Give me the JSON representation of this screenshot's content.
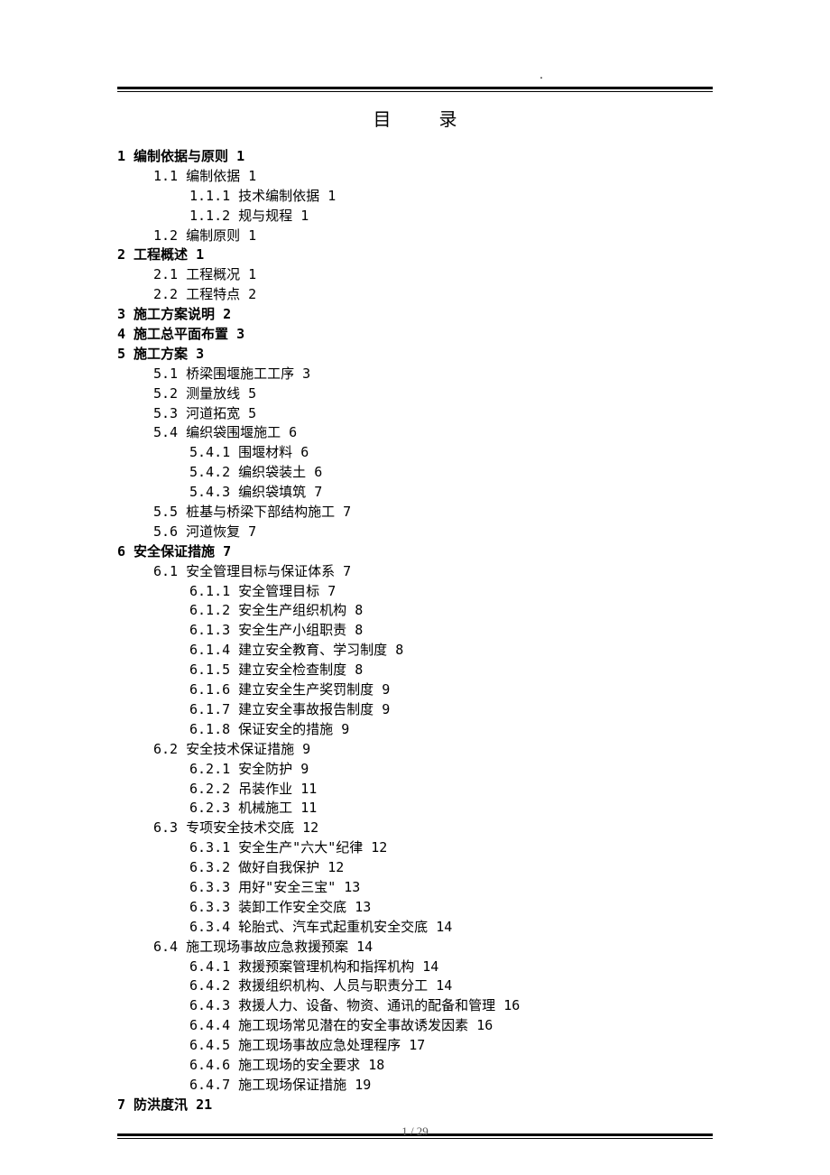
{
  "header_mark": ".",
  "title": "目  录",
  "page_number": "1 / 29",
  "toc": [
    {
      "level": 0,
      "label": "1 编制依据与原则",
      "page": "1"
    },
    {
      "level": 1,
      "label": "1.1 编制依据",
      "page": "1"
    },
    {
      "level": 2,
      "label": "1.1.1 技术编制依据",
      "page": "1"
    },
    {
      "level": 2,
      "label": "1.1.2 规与规程",
      "page": "1"
    },
    {
      "level": 1,
      "label": "1.2 编制原则",
      "page": "1"
    },
    {
      "level": 0,
      "label": "2 工程概述",
      "page": "1"
    },
    {
      "level": 1,
      "label": "2.1 工程概况",
      "page": "1"
    },
    {
      "level": 1,
      "label": "2.2 工程特点",
      "page": "2"
    },
    {
      "level": 0,
      "label": "3 施工方案说明",
      "page": "2"
    },
    {
      "level": 0,
      "label": "4 施工总平面布置",
      "page": "3"
    },
    {
      "level": 0,
      "label": "5 施工方案",
      "page": "3"
    },
    {
      "level": 1,
      "label": "5.1 桥梁围堰施工工序",
      "page": "3"
    },
    {
      "level": 1,
      "label": "5.2 测量放线",
      "page": "5"
    },
    {
      "level": 1,
      "label": "5.3 河道拓宽",
      "page": "5"
    },
    {
      "level": 1,
      "label": "5.4 编织袋围堰施工",
      "page": "6"
    },
    {
      "level": 2,
      "label": "5.4.1 围堰材料",
      "page": "6"
    },
    {
      "level": 2,
      "label": "5.4.2 编织袋装土",
      "page": "6"
    },
    {
      "level": 2,
      "label": "5.4.3 编织袋填筑",
      "page": "7"
    },
    {
      "level": 1,
      "label": "5.5 桩基与桥梁下部结构施工",
      "page": "7"
    },
    {
      "level": 1,
      "label": "5.6 河道恢复",
      "page": "7"
    },
    {
      "level": 0,
      "label": "6 安全保证措施",
      "page": "7"
    },
    {
      "level": 1,
      "label": "6.1 安全管理目标与保证体系",
      "page": "7"
    },
    {
      "level": 2,
      "label": "6.1.1 安全管理目标",
      "page": "7"
    },
    {
      "level": 2,
      "label": "6.1.2 安全生产组织机构",
      "page": "8"
    },
    {
      "level": 2,
      "label": "6.1.3 安全生产小组职责",
      "page": "8"
    },
    {
      "level": 2,
      "label": "6.1.4 建立安全教育、学习制度",
      "page": "8"
    },
    {
      "level": 2,
      "label": "6.1.5 建立安全检查制度",
      "page": "8"
    },
    {
      "level": 2,
      "label": "6.1.6 建立安全生产奖罚制度",
      "page": "9"
    },
    {
      "level": 2,
      "label": "6.1.7 建立安全事故报告制度",
      "page": "9"
    },
    {
      "level": 2,
      "label": "6.1.8 保证安全的措施",
      "page": "9"
    },
    {
      "level": 1,
      "label": "6.2 安全技术保证措施",
      "page": "9"
    },
    {
      "level": 2,
      "label": "6.2.1 安全防护",
      "page": "9"
    },
    {
      "level": 2,
      "label": "6.2.2 吊装作业",
      "page": "11"
    },
    {
      "level": 2,
      "label": "6.2.3 机械施工",
      "page": "11"
    },
    {
      "level": 1,
      "label": "6.3 专项安全技术交底",
      "page": "12"
    },
    {
      "level": 2,
      "label": "6.3.1 安全生产\"六大\"纪律",
      "page": "12"
    },
    {
      "level": 2,
      "label": "6.3.2 做好自我保护",
      "page": "12"
    },
    {
      "level": 2,
      "label": "6.3.3 用好\"安全三宝\"",
      "page": "13"
    },
    {
      "level": 2,
      "label": "6.3.3 装卸工作安全交底",
      "page": "13"
    },
    {
      "level": 2,
      "label": "6.3.4 轮胎式、汽车式起重机安全交底",
      "page": "14"
    },
    {
      "level": 1,
      "label": "6.4 施工现场事故应急救援预案",
      "page": "14"
    },
    {
      "level": 2,
      "label": "6.4.1 救援预案管理机构和指挥机构",
      "page": "14"
    },
    {
      "level": 2,
      "label": "6.4.2 救援组织机构、人员与职责分工",
      "page": "14"
    },
    {
      "level": 2,
      "label": "6.4.3 救援人力、设备、物资、通讯的配备和管理",
      "page": "16"
    },
    {
      "level": 2,
      "label": "6.4.4 施工现场常见潜在的安全事故诱发因素",
      "page": "16"
    },
    {
      "level": 2,
      "label": "6.4.5 施工现场事故应急处理程序",
      "page": "17"
    },
    {
      "level": 2,
      "label": "6.4.6 施工现场的安全要求",
      "page": "18"
    },
    {
      "level": 2,
      "label": "6.4.7 施工现场保证措施",
      "page": "19"
    },
    {
      "level": 0,
      "label": "7 防洪度汛",
      "page": "21"
    }
  ]
}
